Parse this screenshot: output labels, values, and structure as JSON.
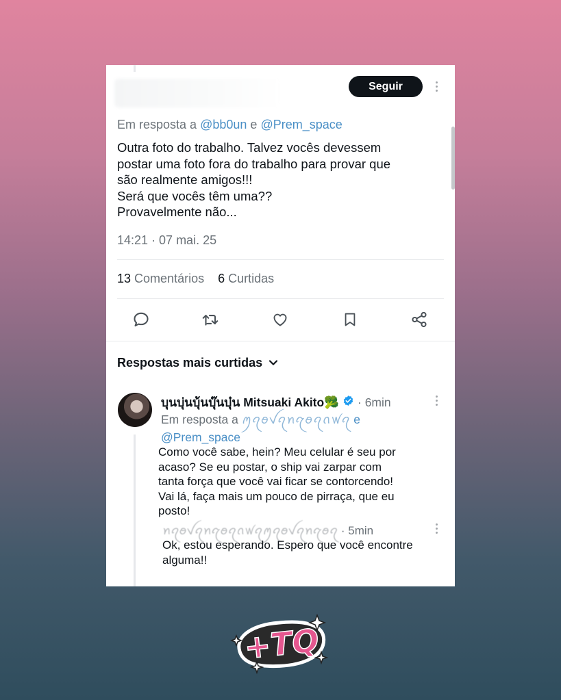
{
  "tweet": {
    "follow_label": "Seguir",
    "reply_prefix": "Em resposta a",
    "mention_1": "@bb0un",
    "conjunction": "e",
    "mention_2": "@Prem_space",
    "text": "Outra foto do trabalho. Talvez vocês devessem\npostar uma foto fora do trabalho para provar que\nsão realmente amigos!!!\nSerá que vocês têm uma??\nProvavelmente não...",
    "timestamp": "14:21 · 07 mai. 25",
    "stats": {
      "comments_count": "13",
      "comments_label": "Comentários",
      "likes_count": "6",
      "likes_label": "Curtidas"
    },
    "actions": [
      "comment-icon",
      "retweet-icon",
      "heart-icon",
      "bookmark-icon",
      "share-icon"
    ]
  },
  "replies_section": {
    "title": "Respostas mais curtidas"
  },
  "reply": {
    "author": "บุนบุ่นบุ้นบุ๊นบุ๋น Mitsuaki Akito🥦",
    "time": "· 6min",
    "reply_prefix": "Em resposta a",
    "blurred_user": "ꪑꪖꪮꪜꪖꪀꪋꪮꪖꪒꪝꪖ",
    "conjunction": "e",
    "mention": "@Prem_space",
    "text": "Como você sabe, hein? Meu celular é seu por\nacaso? Se eu postar, o ship vai zarpar com\ntanta força que você vai ficar se contorcendo!\nVai lá, faça mais um pouco de pirraça, que eu\nposto!"
  },
  "sub_reply": {
    "blurred_name": "ꪀꪖꪮꪜꪖꪀꪋꪮꪖꪒꪝꪖꪑꪖꪮꪜꪖꪀꪋꪮꪖ",
    "time": "· 5min",
    "text": "Ok, estou esperando. Espero que você encontre\nalguma!!"
  },
  "logo": {
    "text": "+TQ"
  },
  "colors": {
    "accent_blue": "#4a8fc6",
    "verified_blue": "#1d9bf0",
    "logo_pink": "#e5578f"
  }
}
